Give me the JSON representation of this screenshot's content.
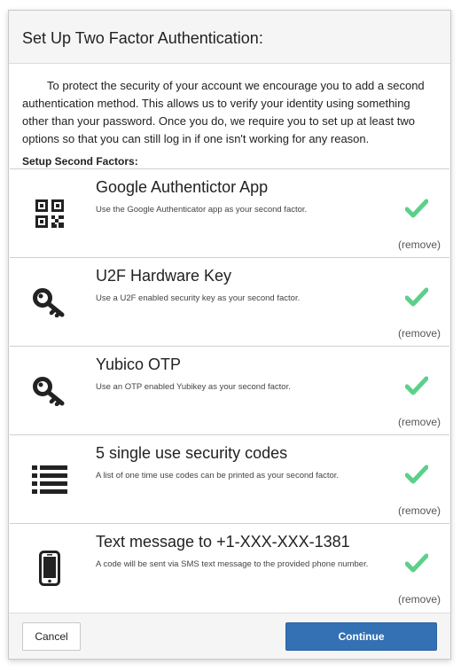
{
  "dialog": {
    "title": "Set Up Two Factor Authentication:",
    "intro": "To protect the security of your account we encourage you to add a second authentication method. This allows us to verify your identity using something other than your password. Once you do, we require you to set up at least two options so that you can still log in if one isn't working for any reason.",
    "section_label": "Setup Second Factors:"
  },
  "factors": [
    {
      "icon": "qr-code-icon",
      "title": "Google Authentictor App",
      "description": "Use the Google Authenticator app as your second factor.",
      "enabled": true,
      "remove_label": "(remove)"
    },
    {
      "icon": "key-icon",
      "title": "U2F Hardware Key",
      "description": "Use a U2F enabled security key as your second factor.",
      "enabled": true,
      "remove_label": "(remove)"
    },
    {
      "icon": "key-icon",
      "title": "Yubico OTP",
      "description": "Use an OTP enabled Yubikey as your second factor.",
      "enabled": true,
      "remove_label": "(remove)"
    },
    {
      "icon": "list-icon",
      "title": "5 single use security codes",
      "description": "A list of one time use codes can be printed as your second factor.",
      "enabled": true,
      "remove_label": "(remove)"
    },
    {
      "icon": "phone-icon",
      "title": "Text message to +1-XXX-XXX-1381",
      "description": "A code will be sent via SMS text message to the provided phone number.",
      "enabled": true,
      "remove_label": "(remove)"
    }
  ],
  "footer": {
    "cancel_label": "Cancel",
    "continue_label": "Continue"
  },
  "colors": {
    "check": "#5cd08a",
    "primary": "#3371b4",
    "icon": "#222222"
  }
}
